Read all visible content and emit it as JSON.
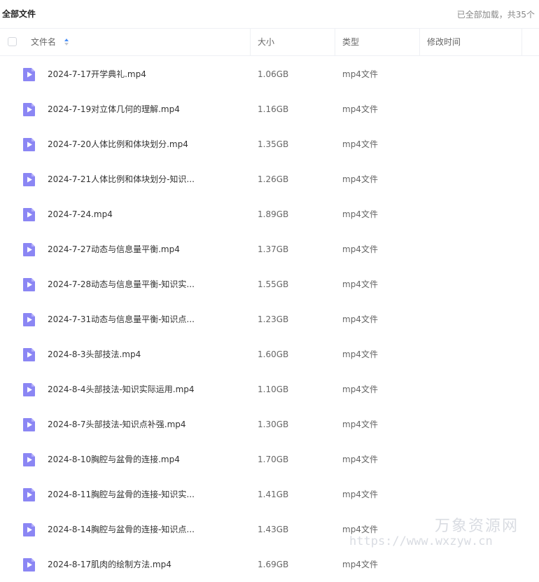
{
  "header": {
    "title": "全部文件",
    "status": "已全部加载，共35个"
  },
  "columns": {
    "name": "文件名",
    "size": "大小",
    "type": "类型",
    "modified": "修改时间"
  },
  "icons": {
    "sort": "sort-icon",
    "file": "video-file-icon"
  },
  "colors": {
    "file_icon": "#8b86f4",
    "sort_active": "#4a8ff7"
  },
  "files": [
    {
      "name": "2024-7-17开学典礼.mp4",
      "size": "1.06GB",
      "type": "mp4文件"
    },
    {
      "name": "2024-7-19对立体几何的理解.mp4",
      "size": "1.16GB",
      "type": "mp4文件"
    },
    {
      "name": "2024-7-20人体比例和体块划分.mp4",
      "size": "1.35GB",
      "type": "mp4文件"
    },
    {
      "name": "2024-7-21人体比例和体块划分-知识...",
      "size": "1.26GB",
      "type": "mp4文件"
    },
    {
      "name": "2024-7-24.mp4",
      "size": "1.89GB",
      "type": "mp4文件"
    },
    {
      "name": "2024-7-27动态与信息量平衡.mp4",
      "size": "1.37GB",
      "type": "mp4文件"
    },
    {
      "name": "2024-7-28动态与信息量平衡-知识实...",
      "size": "1.55GB",
      "type": "mp4文件"
    },
    {
      "name": "2024-7-31动态与信息量平衡-知识点...",
      "size": "1.23GB",
      "type": "mp4文件"
    },
    {
      "name": "2024-8-3头部技法.mp4",
      "size": "1.60GB",
      "type": "mp4文件"
    },
    {
      "name": "2024-8-4头部技法-知识实际运用.mp4",
      "size": "1.10GB",
      "type": "mp4文件"
    },
    {
      "name": "2024-8-7头部技法-知识点补强.mp4",
      "size": "1.30GB",
      "type": "mp4文件"
    },
    {
      "name": "2024-8-10胸腔与盆骨的连接.mp4",
      "size": "1.70GB",
      "type": "mp4文件"
    },
    {
      "name": "2024-8-11胸腔与盆骨的连接-知识实...",
      "size": "1.41GB",
      "type": "mp4文件"
    },
    {
      "name": "2024-8-14胸腔与盆骨的连接-知识点...",
      "size": "1.43GB",
      "type": "mp4文件"
    },
    {
      "name": "2024-8-17肌肉的绘制方法.mp4",
      "size": "1.69GB",
      "type": "mp4文件"
    }
  ],
  "watermark": {
    "name": "万象资源网",
    "url": "https://www.wxzyw.cn"
  }
}
